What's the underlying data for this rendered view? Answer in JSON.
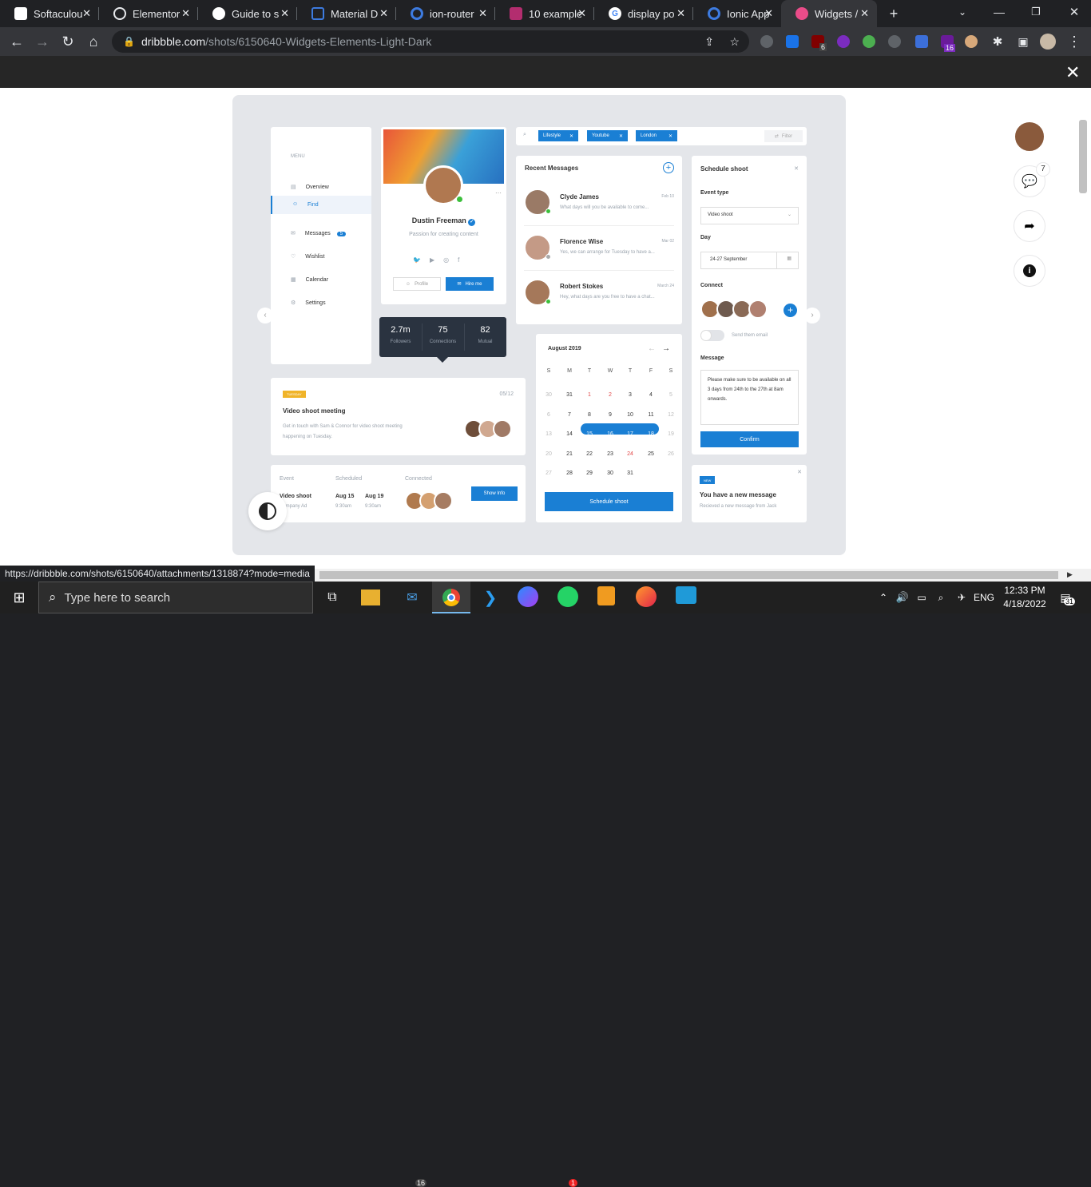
{
  "tabs": [
    {
      "label": "Softaculou",
      "color": "#e8eaed"
    },
    {
      "label": "Elementor",
      "color": "#9aa0a6"
    },
    {
      "label": "Guide to s",
      "color": "#e8eaed"
    },
    {
      "label": "Material D",
      "color": "#3d7be0"
    },
    {
      "label": "ion-router",
      "color": "#3d7be0"
    },
    {
      "label": "10 example",
      "color": "#b32d6f"
    },
    {
      "label": "display po",
      "color": "#4285f4"
    },
    {
      "label": "Ionic App",
      "color": "#3d7be0"
    },
    {
      "label": "Widgets /",
      "color": "#ea4c89"
    }
  ],
  "url": {
    "host": "dribbble.com",
    "path": "/shots/6150640-Widgets-Elements-Light-Dark"
  },
  "badges": {
    "ublock": "6",
    "ext16": "16"
  },
  "menu": {
    "title": "MENU",
    "items": [
      "Overview",
      "Find",
      "Messages",
      "Wishlist",
      "Calendar",
      "Settings"
    ],
    "messages_count": "5"
  },
  "profile": {
    "name": "Dustin Freeman",
    "tagline": "Passion for creating content",
    "profile_btn": "Profile",
    "hire_btn": "Hire me"
  },
  "stats": [
    {
      "value": "2.7m",
      "label": "Followers"
    },
    {
      "value": "75",
      "label": "Connections"
    },
    {
      "value": "82",
      "label": "Mutual"
    }
  ],
  "filters": {
    "chips": [
      "Lifestyle",
      "Youtube",
      "London"
    ],
    "filter_label": "Filter"
  },
  "messages": {
    "title": "Recent Messages",
    "items": [
      {
        "name": "Clyde James",
        "text": "What days will you be available to come...",
        "date": "Feb 10"
      },
      {
        "name": "Florence Wise",
        "text": "Yes, we can arrange for Tuesday to have a...",
        "date": "Mar 02"
      },
      {
        "name": "Robert Stokes",
        "text": "Hey, what days are you free to have a chat...",
        "date": "March 24"
      }
    ]
  },
  "schedule": {
    "title": "Schedule shoot",
    "event_type_label": "Event type",
    "event_type": "Video shoot",
    "day_label": "Day",
    "day": "24-27 September",
    "connect_label": "Connect",
    "email_label": "Send them email",
    "message_label": "Message",
    "message": "Please make sure to be available on all 3 days from 24th to the 27th at 8am onwards.",
    "confirm": "Confirm"
  },
  "calendar": {
    "month": "August 2019",
    "weekdays": [
      "S",
      "M",
      "T",
      "W",
      "T",
      "F",
      "S"
    ],
    "rows": [
      [
        "30",
        "31",
        "1",
        "2",
        "3",
        "4",
        "5"
      ],
      [
        "6",
        "7",
        "8",
        "9",
        "10",
        "11",
        "12"
      ],
      [
        "13",
        "14",
        "15",
        "16",
        "17",
        "18",
        "19"
      ],
      [
        "20",
        "21",
        "22",
        "23",
        "24",
        "25",
        "26"
      ],
      [
        "27",
        "28",
        "29",
        "30",
        "31",
        "",
        ""
      ]
    ],
    "button": "Schedule shoot"
  },
  "meeting": {
    "tag": "TUESDAY",
    "date": "05/12",
    "title": "Video shoot meeting",
    "desc": "Get in touch with Sam & Connor for video shoot meeting happening on Tuesday."
  },
  "event_table": {
    "headers": [
      "Event",
      "Scheduled",
      "Connected"
    ],
    "event": "Video shoot",
    "company": "Company Ad",
    "d1": "Aug 15",
    "t1": "9:30am",
    "d2": "Aug 19",
    "t2": "9:30am",
    "button": "Show Info"
  },
  "notify": {
    "tag": "NEW",
    "title": "You have a new message",
    "text": "Recieved a new message from Jack"
  },
  "comments_count": "7",
  "status_url": "https://dribbble.com/shots/6150640/attachments/1318874?mode=media",
  "taskbar": {
    "search": "Type here to search",
    "mail_badge": "16",
    "whatsapp_badge": "1",
    "lang": "ENG",
    "time": "12:33 PM",
    "date": "4/18/2022",
    "notif": "31"
  }
}
